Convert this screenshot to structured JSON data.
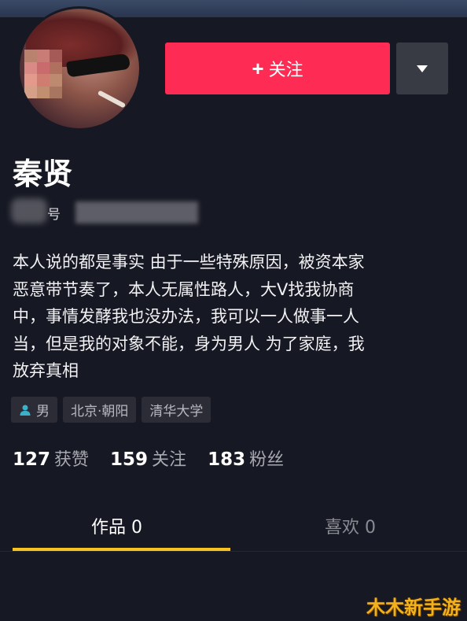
{
  "profile": {
    "name": "秦贤",
    "id_label": "号",
    "follow_label": "关注",
    "follow_plus": "+",
    "bio_lines": [
      "本人说的都是事实  由于一些特殊原因，被资本家",
      "恶意带节奏了，本人无属性路人，大V找我协商",
      "中，事情发酵我也没办法，我可以一人做事一人",
      "当，但是我的对象不能，身为男人 为了家庭，我",
      "放弃真相"
    ],
    "tags": {
      "gender": "男",
      "location": "北京·朝阳",
      "school": "清华大学"
    }
  },
  "stats": {
    "likes_count": "127",
    "likes_label": "获赞",
    "following_count": "159",
    "following_label": "关注",
    "followers_count": "183",
    "followers_label": "粉丝"
  },
  "tabs": {
    "works": "作品 0",
    "likes": "喜欢 0"
  },
  "watermark": "木木新手游",
  "colors": {
    "background": "#161823",
    "follow_button": "#fe2c55",
    "tab_indicator": "#f9c223",
    "watermark": "#f4b21a"
  },
  "icons": {
    "more": "caret-down-icon",
    "gender": "person-icon"
  }
}
